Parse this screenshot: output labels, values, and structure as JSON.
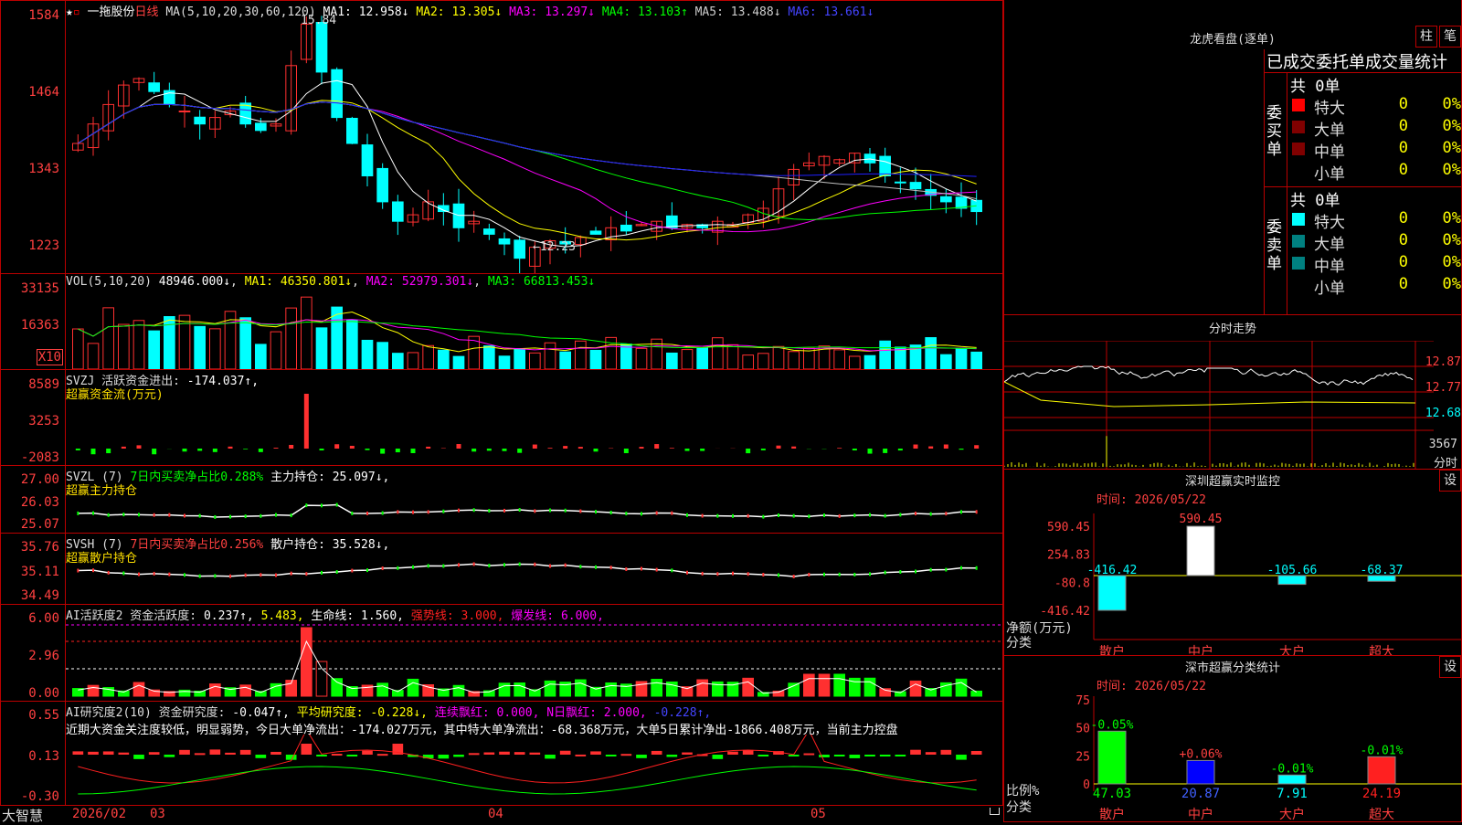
{
  "main": {
    "header_name": "一拖股份",
    "period": "日线",
    "ma_params": "MA(5,10,20,30,60,120)",
    "ma": [
      {
        "label": "MA1:",
        "value": "12.958↓",
        "color": "#ffffff"
      },
      {
        "label": "MA2:",
        "value": "13.305↓",
        "color": "#ffff00"
      },
      {
        "label": "MA3:",
        "value": "13.297↓",
        "color": "#ff00ff"
      },
      {
        "label": "MA4:",
        "value": "13.103↑",
        "color": "#00ff00"
      },
      {
        "label": "MA5:",
        "value": "13.488↓",
        "color": "#c0c0c0"
      },
      {
        "label": "MA6:",
        "value": "13.661↓",
        "color": "#2020ff"
      }
    ],
    "y_ticks": [
      "1584",
      "1464",
      "1343",
      "1223"
    ],
    "high_marker": "15.84",
    "low_marker": "←12.23",
    "date_labels": [
      "2026/02",
      "03",
      "04",
      "05"
    ],
    "brand": "大智慧"
  },
  "vol": {
    "header": "VOL(5,10,20)",
    "value": "48946.000↓",
    "ma": [
      {
        "label": "MA1:",
        "value": "46350.801↓",
        "color": "#ffff00"
      },
      {
        "label": "MA2:",
        "value": "52979.301↓",
        "color": "#ff00ff"
      },
      {
        "label": "MA3:",
        "value": "66813.453↓",
        "color": "#00ff00"
      }
    ],
    "y_ticks": [
      "33135",
      "16363"
    ],
    "unit": "X10"
  },
  "svzj": {
    "header": "SVZJ  活跃资金进出:",
    "value": "-174.037↑,",
    "subtitle": "超赢资金流(万元)",
    "y_ticks": [
      "8589",
      "3253",
      "-2083"
    ]
  },
  "svzl": {
    "header": "SVZL (7)",
    "ratio": "7日内买卖净占比0.288%",
    "hold": "主力持仓: 25.097↓,",
    "subtitle": "超赢主力持仓",
    "y_ticks": [
      "27.00",
      "26.03",
      "25.07"
    ]
  },
  "svsh": {
    "header": "SVSH (7)",
    "ratio": "7日内买卖净占比0.256%",
    "hold": "散户持仓: 35.528↓,",
    "subtitle": "超赢散户持仓",
    "y_ticks": [
      "35.76",
      "35.11",
      "34.49"
    ]
  },
  "ai_active": {
    "header": "AI活跃度2 资金活跃度:",
    "v1": "0.237↑,",
    "v2": "5.483,",
    "life": "生命线: 1.560,",
    "strong": "强势线: 3.000,",
    "burst": "爆发线: 6.000,",
    "y_ticks": [
      "6.00",
      "2.96",
      "0.00"
    ]
  },
  "ai_research": {
    "header": "AI研究度2(10) 资金研究度:",
    "v1": "-0.047↑,",
    "avg": "平均研究度: -0.228↓,",
    "cont": "连续飘红: 0.000,",
    "nday": "N日飘红: 2.000,",
    "last": "-0.228↑,",
    "comment": "近期大资金关注度较低，明显弱势，今日大单净流出：-174.027万元，其中特大单净流出：-68.368万元，大单5日累计净出-1866.408万元，当前主力控盘",
    "y_ticks": [
      "0.55",
      "0.13",
      "-0.30"
    ]
  },
  "longhu": {
    "title": "龙虎看盘(逐单)",
    "btn1": "柱",
    "btn2": "笔",
    "subtitle": "已成交委托单成交量统计",
    "buy_group": "委买单",
    "sell_group": "委卖单",
    "buy_total": "共 0单",
    "sell_total": "共 0单",
    "buy_rows": [
      {
        "label": "特大",
        "count": "0",
        "pct": "0%",
        "color": "#ff0000"
      },
      {
        "label": "大单",
        "count": "0",
        "pct": "0%",
        "color": "#800000"
      },
      {
        "label": "中单",
        "count": "0",
        "pct": "0%",
        "color": "#800000"
      },
      {
        "label": "小单",
        "count": "0",
        "pct": "0%",
        "color": "#000000"
      }
    ],
    "sell_rows": [
      {
        "label": "特大",
        "count": "0",
        "pct": "0%",
        "color": "#00ffff"
      },
      {
        "label": "大单",
        "count": "0",
        "pct": "0%",
        "color": "#008080"
      },
      {
        "label": "中单",
        "count": "0",
        "pct": "0%",
        "color": "#008080"
      },
      {
        "label": "小单",
        "count": "0",
        "pct": "0%",
        "color": "#000000"
      }
    ]
  },
  "fenshi": {
    "title": "分时走势",
    "y_ticks": [
      "12.87",
      "12.77",
      "12.68"
    ],
    "vol_label": "3567",
    "unit": "分时"
  },
  "monitor": {
    "title": "深圳超赢实时监控",
    "btn": "设",
    "time": "时间: 2026/05/22",
    "y_ticks": [
      "590.45",
      "254.83",
      "-80.8",
      "-416.42"
    ],
    "yaxis_label": "净额(万元)",
    "xaxis_label": "分类",
    "categories": [
      "散户",
      "中户",
      "大户",
      "超大"
    ],
    "values": [
      -416.42,
      590.45,
      -105.66,
      -68.37
    ],
    "value_labels": [
      "-416.42",
      "590.45",
      "-105.66",
      "-68.37"
    ]
  },
  "classify": {
    "title": "深市超赢分类统计",
    "btn": "设",
    "time": "时间: 2026/05/22",
    "y_ticks": [
      "75",
      "50",
      "25",
      "0"
    ],
    "yaxis_label": "比例%",
    "xaxis_label": "分类",
    "categories": [
      "散户",
      "中户",
      "大户",
      "超大"
    ],
    "values": [
      47.03,
      20.87,
      7.91,
      24.19
    ],
    "value_labels": [
      "47.03",
      "20.87",
      "7.91",
      "24.19"
    ],
    "change_labels": [
      "-0.05%",
      "+0.06%",
      "-0.01%",
      "-0.01%"
    ],
    "colors": [
      "#00ff00",
      "#0000ff",
      "#00ffff",
      "#ff2020"
    ]
  },
  "colors": {
    "up": "#ff3030",
    "down": "#00ffff",
    "border": "#bb0000"
  }
}
